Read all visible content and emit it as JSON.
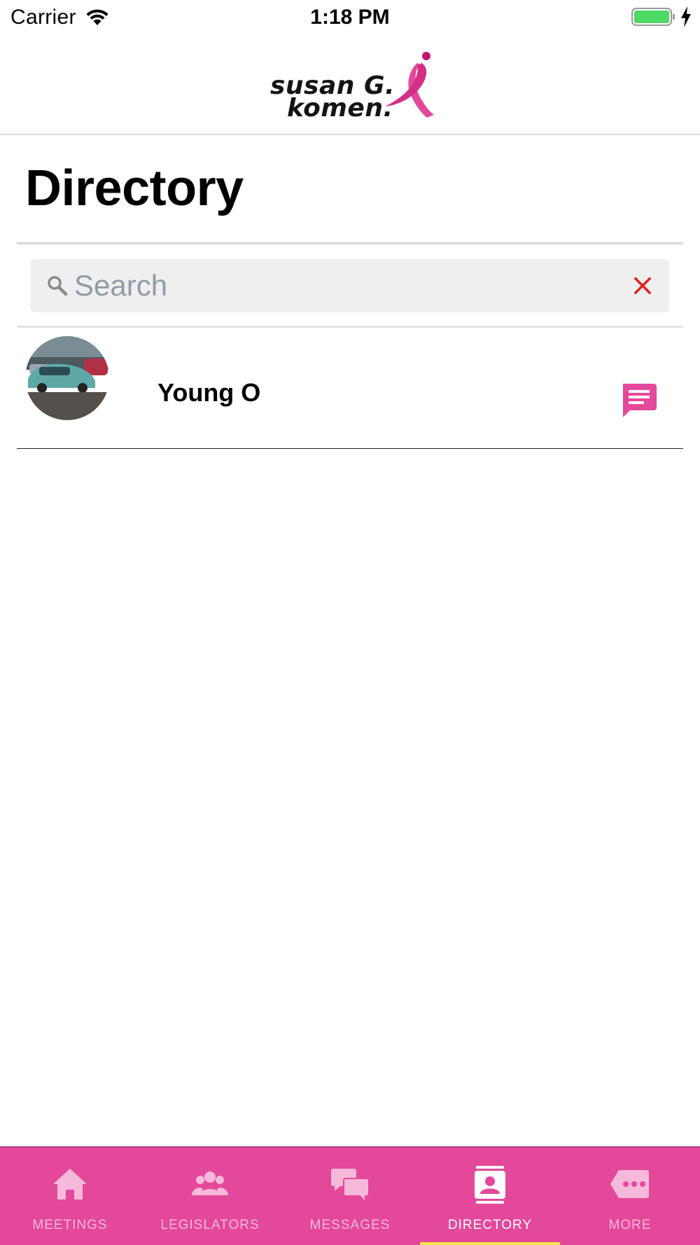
{
  "status_bar": {
    "carrier": "Carrier",
    "time": "1:18 PM",
    "battery_color": "#4cd964"
  },
  "header": {
    "logo_line1": "susan G.",
    "logo_line2": "komen.",
    "logo_mark": "®",
    "brand_color": "#e4489b"
  },
  "page": {
    "title": "Directory"
  },
  "search": {
    "placeholder": "Search",
    "value": "",
    "search_icon": "search-icon",
    "clear_icon": "close-icon",
    "clear_color": "#e02020"
  },
  "directory": {
    "items": [
      {
        "name": "Young O",
        "avatar": "car-photo-avatar",
        "action_icon": "chat-icon"
      }
    ]
  },
  "tab_bar": {
    "background": "#e4489b",
    "indicator_color": "#f5e64a",
    "active_tab": "DIRECTORY",
    "tabs": [
      {
        "label": "MEETINGS",
        "icon": "home-icon"
      },
      {
        "label": "LEGISLATORS",
        "icon": "people-icon"
      },
      {
        "label": "MESSAGES",
        "icon": "chat-bubbles-icon"
      },
      {
        "label": "DIRECTORY",
        "icon": "contact-card-icon"
      },
      {
        "label": "MORE",
        "icon": "more-tag-icon"
      }
    ]
  }
}
